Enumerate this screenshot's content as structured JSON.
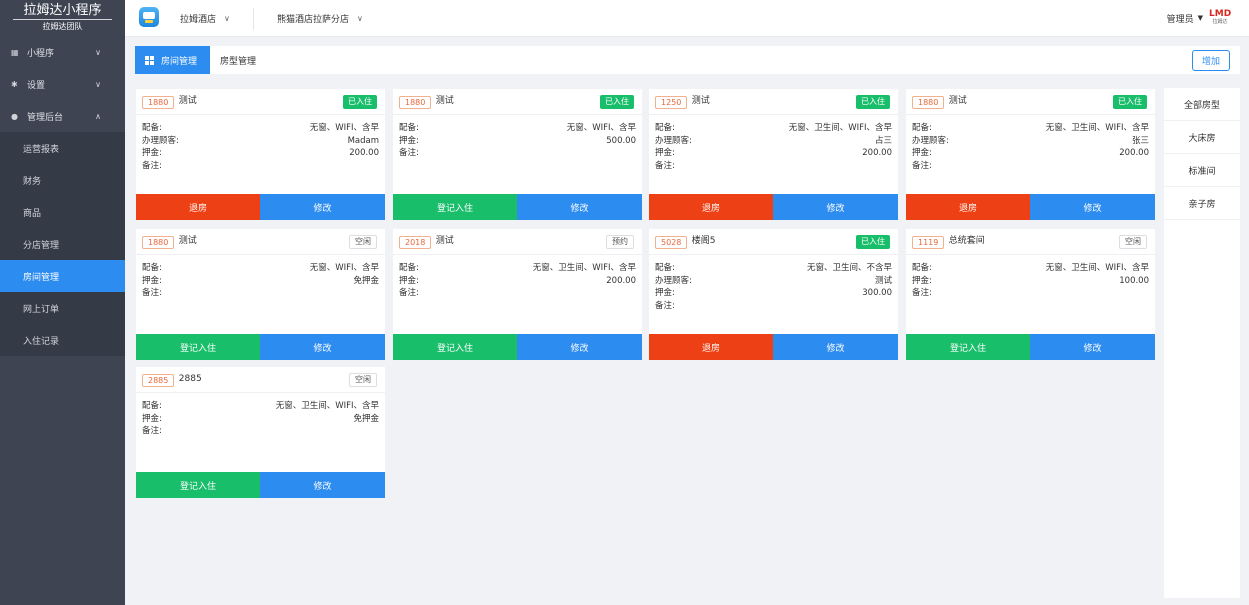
{
  "brand": {
    "title": "拉姆达小程序",
    "subtitle": "拉姆达团队"
  },
  "sidebar": {
    "groups": [
      {
        "label": "小程序",
        "icon": "grid-icon"
      },
      {
        "label": "设置",
        "icon": "gear-icon"
      },
      {
        "label": "管理后台",
        "icon": "dot-icon"
      }
    ],
    "sub_items": [
      "运营报表",
      "财务",
      "商品",
      "分店管理",
      "房间管理",
      "网上订单",
      "入住记录"
    ],
    "active_sub": "房间管理"
  },
  "header": {
    "hotel": "拉姆酒店",
    "branch": "熊猫酒店拉萨分店",
    "user": "管理员",
    "logo_text": "LMD",
    "logo_sub": "拉姆达"
  },
  "tabs": {
    "active": "房间管理",
    "second": "房型管理",
    "add_label": "增加"
  },
  "labels": {
    "amenities": "配备:",
    "guest": "办理顾客:",
    "deposit": "押金:",
    "note": "备注:",
    "checkout": "退房",
    "checkin": "登记入住",
    "edit": "修改"
  },
  "rooms": [
    {
      "no": "1880",
      "name": "测试",
      "status": "已入住",
      "amenities": "无窗、WIFI、含早",
      "guest": "Madam",
      "deposit": "200.00"
    },
    {
      "no": "1880",
      "name": "测试",
      "status": "已入住",
      "amenities": "无窗、WIFI、含早",
      "deposit": "500.00"
    },
    {
      "no": "1250",
      "name": "测试",
      "status": "已入住",
      "amenities": "无窗、卫生间、WIFI、含早",
      "guest": "占三",
      "deposit": "200.00"
    },
    {
      "no": "1880",
      "name": "测试",
      "status": "已入住",
      "amenities": "无窗、卫生间、WIFI、含早",
      "guest": "张三",
      "deposit": "200.00"
    },
    {
      "no": "1880",
      "name": "测试",
      "status": "空闲",
      "amenities": "无窗、WIFI、含早",
      "deposit": "免押金"
    },
    {
      "no": "2018",
      "name": "测试",
      "status": "预约",
      "amenities": "无窗、卫生间、WIFI、含早",
      "deposit": "200.00"
    },
    {
      "no": "5028",
      "name": "楼阁5",
      "status": "已入住",
      "amenities": "无窗、卫生间、不含早",
      "guest": "测试",
      "deposit": "300.00"
    },
    {
      "no": "1119",
      "name": "总统套间",
      "status": "空闲",
      "amenities": "无窗、卫生间、WIFI、含早",
      "deposit": "100.00"
    },
    {
      "no": "2885",
      "name": "2885",
      "status": "空闲",
      "amenities": "无窗、卫生间、WIFI、含早",
      "deposit": "免押金"
    }
  ],
  "room_types": [
    "全部房型",
    "大床房",
    "标准间",
    "亲子房"
  ]
}
